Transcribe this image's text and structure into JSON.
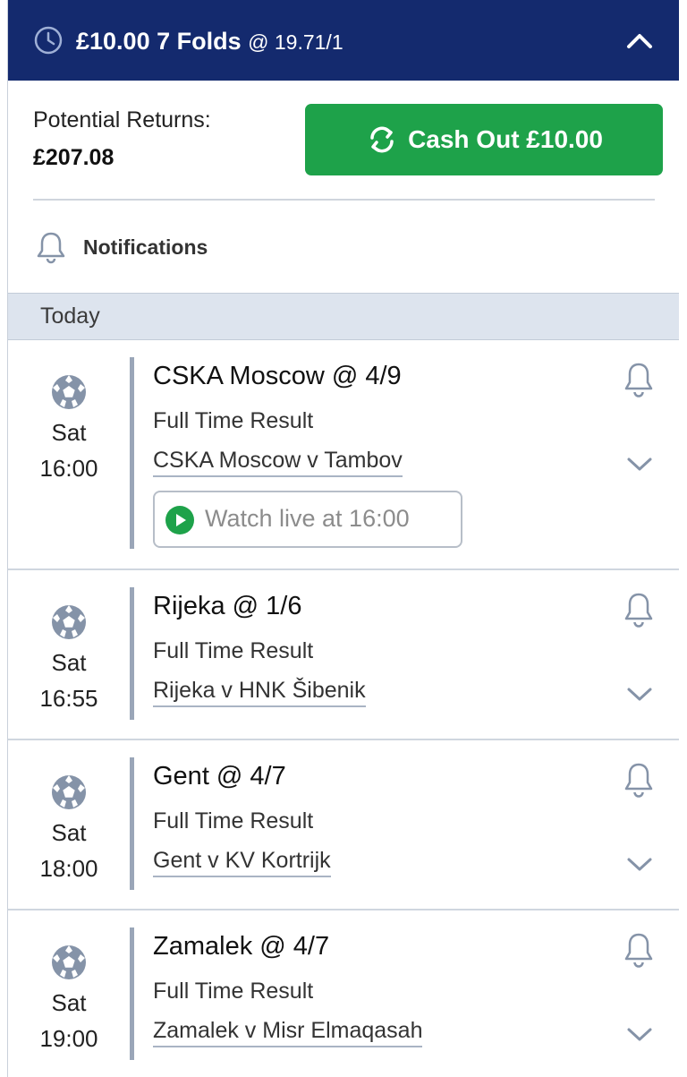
{
  "header": {
    "stake": "£10.00",
    "bet_type": "7 Folds",
    "odds": "@ 19.71/1"
  },
  "summary": {
    "potential_returns_label": "Potential Returns:",
    "potential_returns_value": "£207.08",
    "cash_out_label": "Cash Out £10.00",
    "notifications_label": "Notifications"
  },
  "section": {
    "title": "Today"
  },
  "events": [
    {
      "selection": "CSKA Moscow @ 4/9",
      "market": "Full Time Result",
      "match": "CSKA Moscow v Tambov",
      "day": "Sat",
      "time": "16:00",
      "watch_label": "Watch live at 16:00"
    },
    {
      "selection": "Rijeka @ 1/6",
      "market": "Full Time Result",
      "match": "Rijeka v HNK Šibenik",
      "day": "Sat",
      "time": "16:55"
    },
    {
      "selection": "Gent @ 4/7",
      "market": "Full Time Result",
      "match": "Gent v KV Kortrijk",
      "day": "Sat",
      "time": "18:00"
    },
    {
      "selection": "Zamalek @ 4/7",
      "market": "Full Time Result",
      "match": "Zamalek v Misr Elmaqasah",
      "day": "Sat",
      "time": "19:00"
    }
  ],
  "colors": {
    "header_bg": "#142a6e",
    "cash_out_green": "#1ea24a",
    "section_bg": "#dde4ee"
  },
  "icons": [
    "clock-icon",
    "chevron-up-icon",
    "refresh-icon",
    "bell-icon",
    "football-icon",
    "chevron-down-icon",
    "play-icon"
  ]
}
